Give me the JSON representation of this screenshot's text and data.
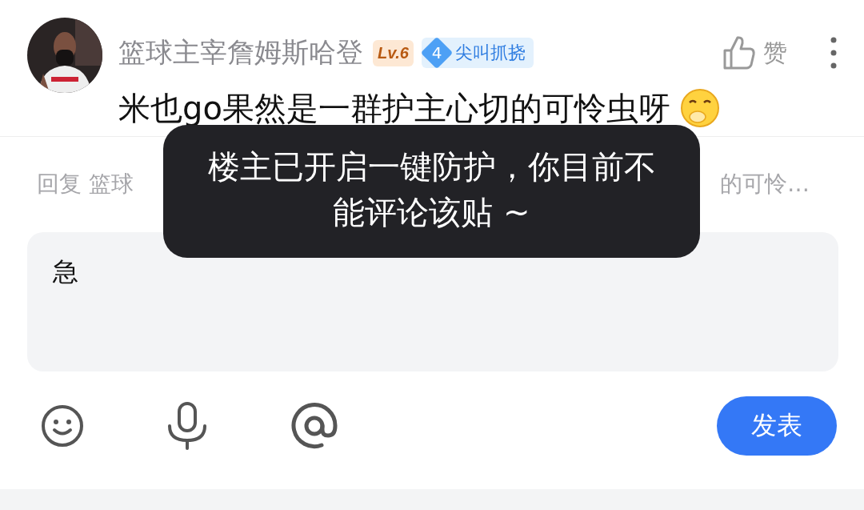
{
  "comment": {
    "username": "篮球主宰詹姆斯哈登",
    "level_badge": "Lv.6",
    "fan_badge": {
      "number": "4",
      "title": "尖叫抓挠"
    },
    "like_label": "赞",
    "text": "米也go果然是一群护主心切的可怜虫呀"
  },
  "reply_hint": {
    "left": "回复 篮球",
    "right": "的可怜…"
  },
  "input": {
    "value": "急"
  },
  "toolbar": [
    {
      "kind": "emoji"
    },
    {
      "kind": "voice"
    },
    {
      "kind": "mention"
    }
  ],
  "submit_button": "发表",
  "toast": "楼主已开启一键防护，你目前不能评论该贴 ~"
}
